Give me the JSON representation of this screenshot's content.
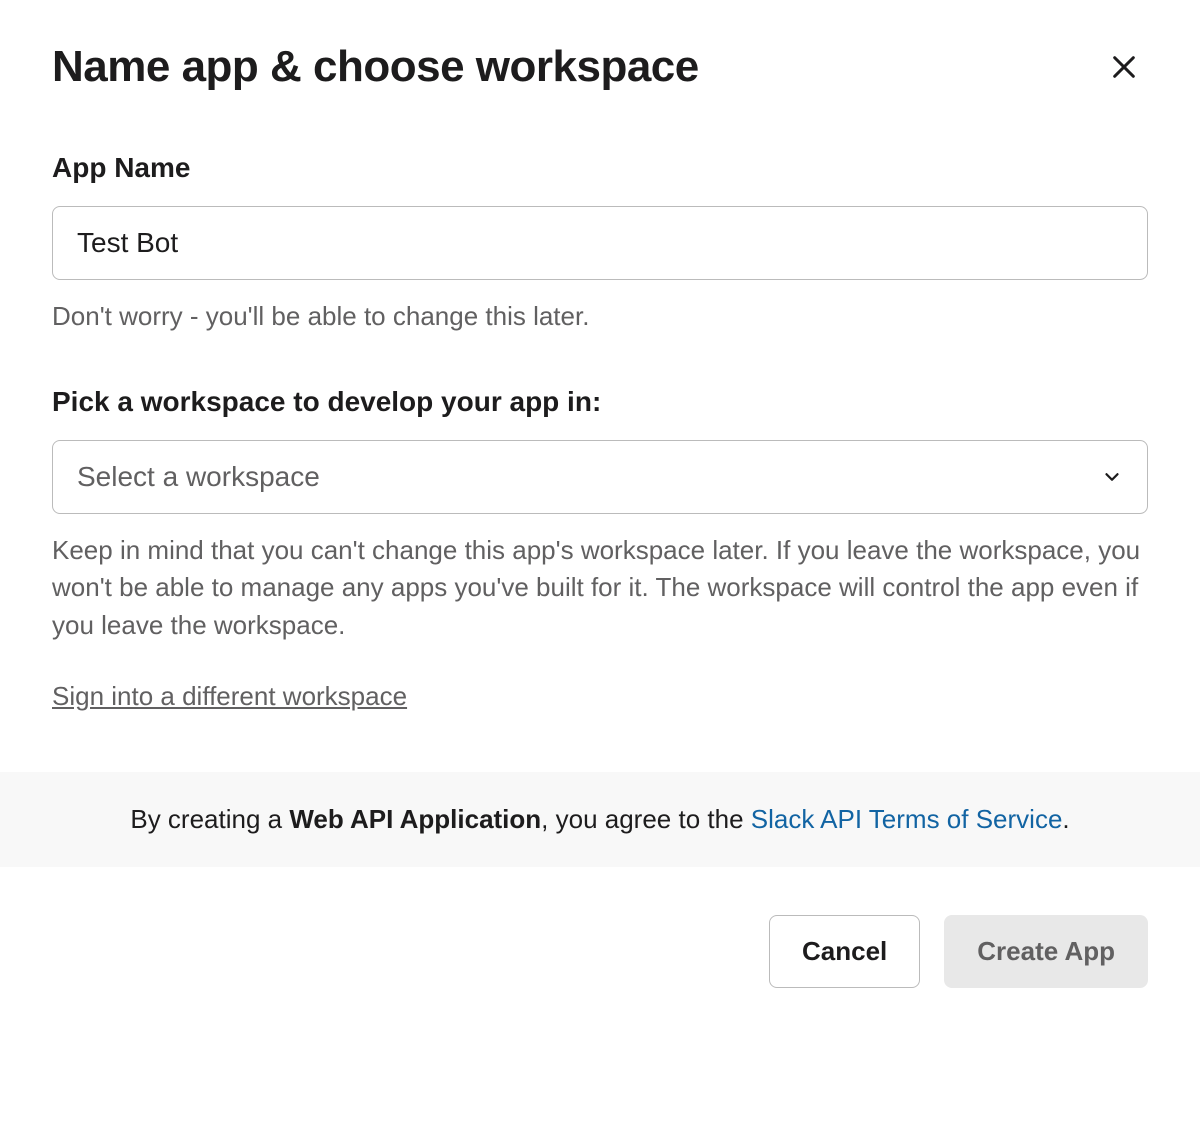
{
  "header": {
    "title": "Name app & choose workspace"
  },
  "appName": {
    "label": "App Name",
    "value": "Test Bot",
    "helpText": "Don't worry - you'll be able to change this later."
  },
  "workspace": {
    "label": "Pick a workspace to develop your app in:",
    "placeholder": "Select a workspace",
    "helpText": "Keep in mind that you can't change this app's workspace later. If you leave the workspace, you won't be able to manage any apps you've built for it. The workspace will control the app even if you leave the workspace.",
    "signinLink": "Sign into a different workspace"
  },
  "terms": {
    "prefix": "By creating a ",
    "bold": "Web API Application",
    "middle": ", you agree to the ",
    "linkText": "Slack API Terms of Service",
    "suffix": "."
  },
  "footer": {
    "cancel": "Cancel",
    "create": "Create App"
  }
}
